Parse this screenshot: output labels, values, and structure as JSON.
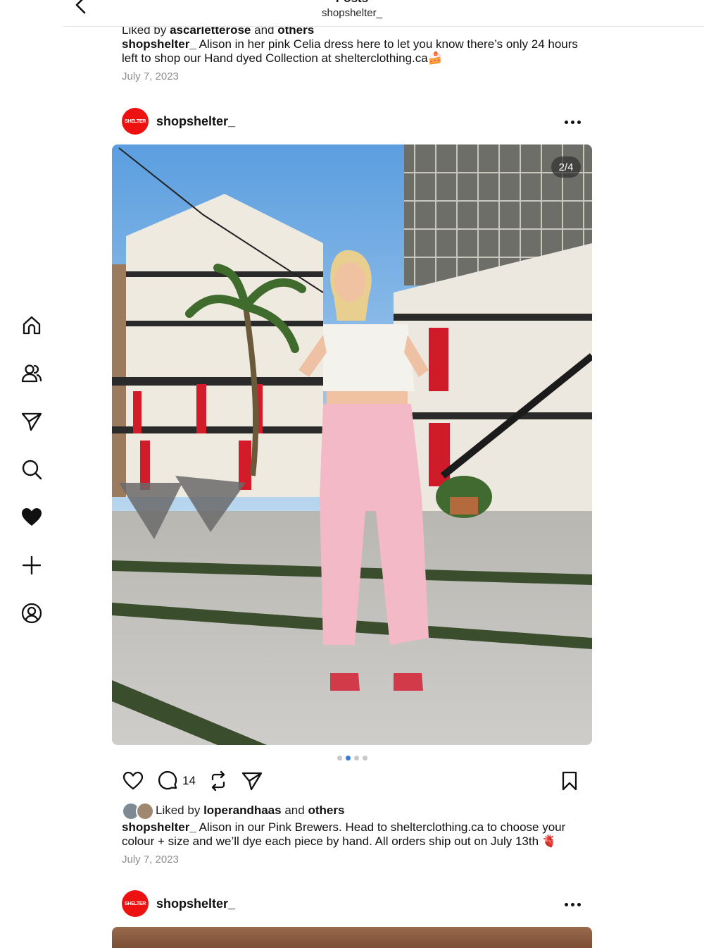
{
  "header": {
    "title": "Posts",
    "subtitle": "shopshelter_"
  },
  "sidebar": {
    "items": [
      {
        "icon": "home-icon"
      },
      {
        "icon": "people-icon"
      },
      {
        "icon": "send-icon"
      },
      {
        "icon": "search-icon"
      },
      {
        "icon": "heart-filled-icon"
      },
      {
        "icon": "plus-icon"
      },
      {
        "icon": "profile-icon"
      }
    ]
  },
  "prev_post": {
    "liked_prefix": "Liked by",
    "liked_user": "ascarletterose",
    "liked_and": "and",
    "liked_others": "others",
    "caption_user": "shopshelter_",
    "caption_text": "Alison in her pink Celia dress here to let you know there’s only 24 hours left to shop our Hand dyed Collection at shelterclothing.ca🍰",
    "date": "July 7, 2023"
  },
  "post": {
    "avatar_text": "SHELTER",
    "username": "shopshelter_",
    "image_counter": "2/4",
    "carousel": {
      "count": 4,
      "active_index": 1
    },
    "comments_count": "14",
    "liked_prefix": "Liked by",
    "liked_user": "loperandhaas",
    "liked_and": "and",
    "liked_others": "others",
    "caption_user": "shopshelter_",
    "caption_text": "Alison in our Pink Brewers. Head to shelterclothing.ca to choose your colour + size and we’ll dye each piece by hand. All orders ship out on July 13th 🫀",
    "date": "July 7, 2023"
  },
  "next_post": {
    "avatar_text": "SHELTER",
    "username": "shopshelter_"
  }
}
